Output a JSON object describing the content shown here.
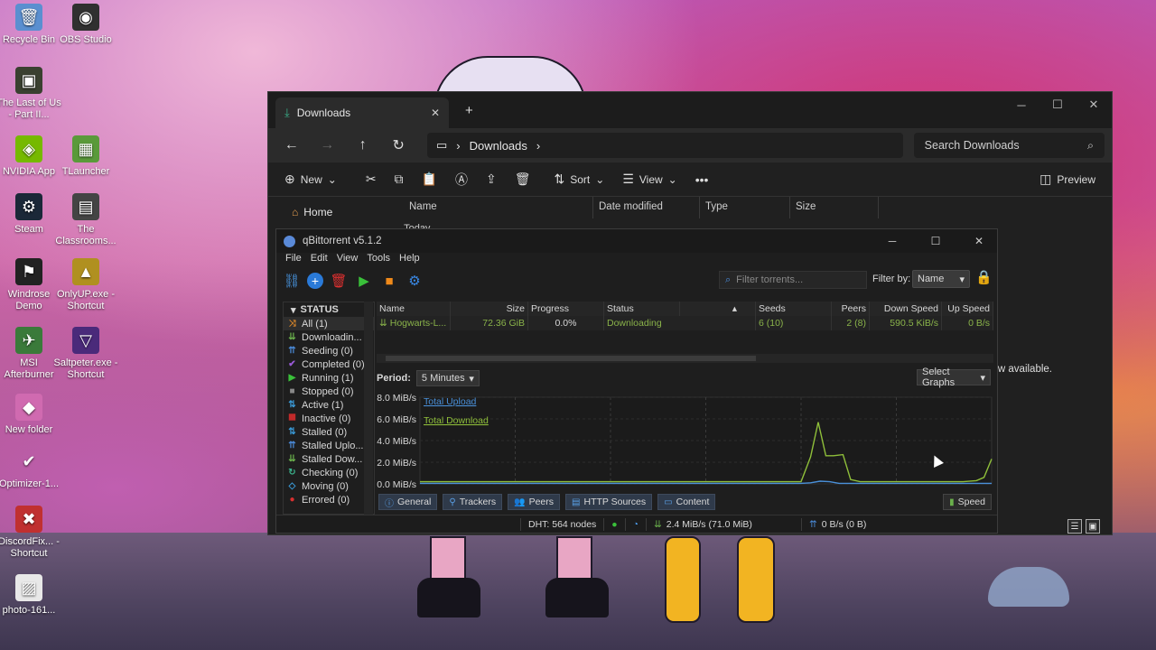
{
  "desktop": {
    "icons": [
      {
        "label": "Recycle Bin",
        "icon": "recycle-bin-icon",
        "glyph": "🗑",
        "color": "#5a8fd0"
      },
      {
        "label": "OBS Studio",
        "icon": "obs-icon",
        "glyph": "◉",
        "color": "#303030"
      },
      {
        "label": "The Last of Us - Part II...",
        "icon": "game-icon",
        "glyph": "▣",
        "color": "#3a4030"
      },
      {
        "label": "NVIDIA App",
        "icon": "nvidia-icon",
        "glyph": "◈",
        "color": "#76b900"
      },
      {
        "label": "TLauncher",
        "icon": "tlauncher-icon",
        "glyph": "▦",
        "color": "#5a9a3a"
      },
      {
        "label": "Steam",
        "icon": "steam-icon",
        "glyph": "⚙",
        "color": "#1b2838"
      },
      {
        "label": "The Classrooms...",
        "icon": "game-icon",
        "glyph": "▤",
        "color": "#444"
      },
      {
        "label": "Windrose Demo",
        "icon": "windrose-icon",
        "glyph": "⚑",
        "color": "#222"
      },
      {
        "label": "OnlyUP.exe - Shortcut",
        "icon": "onlyup-icon",
        "glyph": "▲",
        "color": "#b09020"
      },
      {
        "label": "MSI Afterburner",
        "icon": "msi-icon",
        "glyph": "✈",
        "color": "#3a7a3a"
      },
      {
        "label": "Saltpeter.exe - Shortcut",
        "icon": "saltpeter-icon",
        "glyph": "▽",
        "color": "#4a2a7a"
      },
      {
        "label": "New folder",
        "icon": "folder-icon",
        "glyph": "◆",
        "color": "#d06ab0"
      },
      {
        "label": "Optimizer-1...",
        "icon": "check-icon",
        "glyph": "✔",
        "color": "transparent"
      },
      {
        "label": "DiscordFix... - Shortcut",
        "icon": "discordfix-icon",
        "glyph": "✖",
        "color": "#c03030"
      },
      {
        "label": "photo-161...",
        "icon": "image-file-icon",
        "glyph": "▨",
        "color": "#e8e8e8"
      }
    ]
  },
  "explorer": {
    "tab_title": "Downloads",
    "breadcrumb": [
      "Downloads"
    ],
    "search_placeholder": "Search Downloads",
    "commands": {
      "new": "New",
      "sort": "Sort",
      "view": "View",
      "preview": "Preview"
    },
    "sidebar_home": "Home",
    "columns": [
      "Name",
      "Date modified",
      "Type",
      "Size"
    ],
    "group_today": "Today",
    "preview_text": "iew available."
  },
  "qbt": {
    "title": "qBittorrent v5.1.2",
    "menu": [
      "File",
      "Edit",
      "View",
      "Tools",
      "Help"
    ],
    "filter_placeholder": "Filter torrents...",
    "filter_by_label": "Filter by:",
    "filter_by_value": "Name",
    "status_header": "STATUS",
    "status_items": [
      {
        "label": "All (1)",
        "icon": "shuffle-icon",
        "glyph": "⤨",
        "color": "#e08a2a"
      },
      {
        "label": "Downloadin...",
        "icon": "download-icon",
        "glyph": "⇊",
        "color": "#6ab04c"
      },
      {
        "label": "Seeding (0)",
        "icon": "upload-icon",
        "glyph": "⇈",
        "color": "#4a8ad8"
      },
      {
        "label": "Completed (0)",
        "icon": "check-icon",
        "glyph": "✔",
        "color": "#9a5ad8"
      },
      {
        "label": "Running (1)",
        "icon": "play-icon",
        "glyph": "▶",
        "color": "#3ac03a"
      },
      {
        "label": "Stopped (0)",
        "icon": "stop-icon",
        "glyph": "■",
        "color": "#888888"
      },
      {
        "label": "Active (1)",
        "icon": "updown-icon",
        "glyph": "⇅",
        "color": "#3a9ad8"
      },
      {
        "label": "Inactive (0)",
        "icon": "filter-icon",
        "glyph": "⯀",
        "color": "#c02a2a"
      },
      {
        "label": "Stalled (0)",
        "icon": "updown-icon",
        "glyph": "⇅",
        "color": "#3a9ad8"
      },
      {
        "label": "Stalled Uplo...",
        "icon": "upload-icon",
        "glyph": "⇈",
        "color": "#4a8ad8"
      },
      {
        "label": "Stalled Dow...",
        "icon": "download-icon",
        "glyph": "⇊",
        "color": "#6ab04c"
      },
      {
        "label": "Checking (0)",
        "icon": "refresh-icon",
        "glyph": "↻",
        "color": "#3ab08a"
      },
      {
        "label": "Moving (0)",
        "icon": "moving-icon",
        "glyph": "◇",
        "color": "#3a9ad8"
      },
      {
        "label": "Errored (0)",
        "icon": "error-icon",
        "glyph": "●",
        "color": "#d83030"
      }
    ],
    "table": {
      "columns": [
        "Name",
        "Size",
        "Progress",
        "Status",
        "Seeds",
        "Peers",
        "Down Speed",
        "Up Speed"
      ],
      "rows": [
        {
          "name": "Hogwarts-L...",
          "size": "72.36 GiB",
          "progress": "0.0%",
          "status": "Downloading",
          "seeds": "6 (10)",
          "peers": "2 (8)",
          "down": "590.5 KiB/s",
          "up": "0 B/s"
        }
      ]
    },
    "period_label": "Period:",
    "period_value": "5 Minutes",
    "select_graphs": "Select Graphs",
    "bottom_tabs": [
      "General",
      "Trackers",
      "Peers",
      "HTTP Sources",
      "Content"
    ],
    "speed_tab": "Speed",
    "status_bar": {
      "dht": "DHT: 564 nodes",
      "down": "2.4 MiB/s (71.0 MiB)",
      "up": "0 B/s (0 B)"
    }
  },
  "chart_data": {
    "type": "line",
    "title": "",
    "ylabel": "",
    "y_ticks": [
      "8.0 MiB/s",
      "6.0 MiB/s",
      "4.0 MiB/s",
      "2.0 MiB/s",
      "0.0 MiB/s"
    ],
    "ylim": [
      0,
      8.0
    ],
    "xlim": [
      0,
      300
    ],
    "series": [
      {
        "name": "Total Upload",
        "color": "#4a90d9",
        "x": [
          0,
          200,
          205,
          210,
          215,
          220,
          300
        ],
        "y": [
          0.05,
          0.05,
          0.1,
          0.25,
          0.2,
          0.05,
          0.05
        ]
      },
      {
        "name": "Total Download",
        "color": "#8fbf3a",
        "x": [
          0,
          60,
          120,
          180,
          200,
          205,
          209,
          213,
          217,
          222,
          226,
          231,
          235,
          240,
          260,
          285,
          292,
          296,
          300
        ],
        "y": [
          0.2,
          0.2,
          0.2,
          0.2,
          0.2,
          2.5,
          5.7,
          2.6,
          2.6,
          2.7,
          0.4,
          0.2,
          0.2,
          0.2,
          0.2,
          0.2,
          0.3,
          0.6,
          2.3
        ]
      }
    ]
  }
}
